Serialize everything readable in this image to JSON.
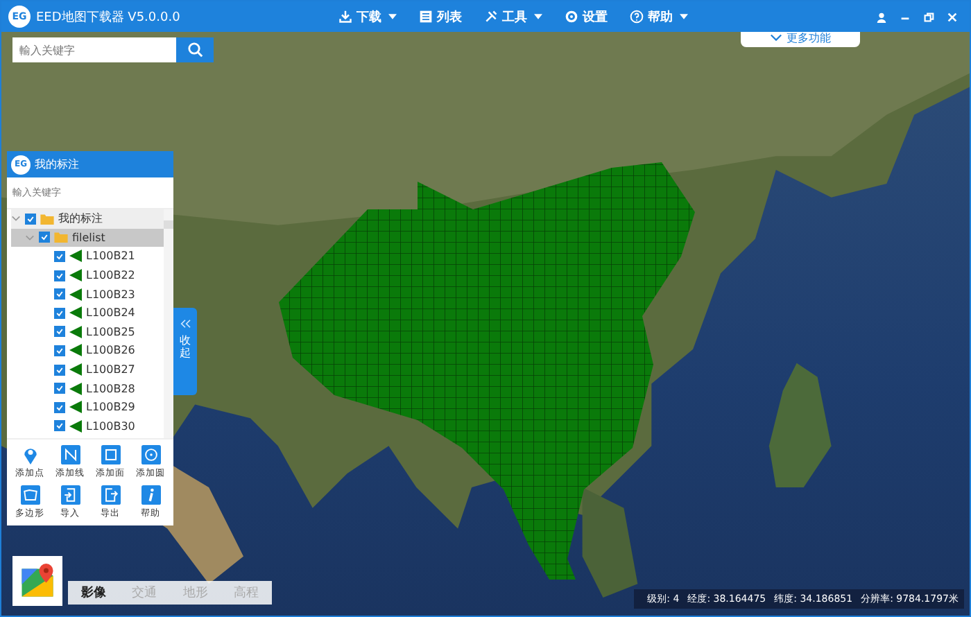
{
  "window": {
    "title": "EED地图下载器 V5.0.0.0",
    "logo": "EG"
  },
  "menu": [
    {
      "label": "下载",
      "kind": "download",
      "dropdown": true
    },
    {
      "label": "列表",
      "kind": "list",
      "dropdown": false
    },
    {
      "label": "工具",
      "kind": "tools",
      "dropdown": true
    },
    {
      "label": "设置",
      "kind": "settings",
      "dropdown": false
    },
    {
      "label": "帮助",
      "kind": "help",
      "dropdown": true
    }
  ],
  "search": {
    "placeholder": "輸入关键字"
  },
  "more_button": {
    "label": "更多功能"
  },
  "panel": {
    "logo": "EG",
    "title": "我的标注",
    "search_placeholder": "輸入关键字",
    "tree": [
      {
        "label": "我的标注",
        "checked": true,
        "expanded": true,
        "selected": false,
        "children": [
          {
            "label": "filelist",
            "checked": true,
            "expanded": true,
            "selected": true,
            "children": [
              {
                "label": "L100B21",
                "checked": true
              },
              {
                "label": "L100B22",
                "checked": true
              },
              {
                "label": "L100B23",
                "checked": true
              },
              {
                "label": "L100B24",
                "checked": true
              },
              {
                "label": "L100B25",
                "checked": true
              },
              {
                "label": "L100B26",
                "checked": true
              },
              {
                "label": "L100B27",
                "checked": true
              },
              {
                "label": "L100B28",
                "checked": true
              },
              {
                "label": "L100B29",
                "checked": true
              },
              {
                "label": "L100B30",
                "checked": true
              }
            ]
          }
        ]
      }
    ],
    "tools": [
      {
        "label": "添加点",
        "kind": "point"
      },
      {
        "label": "添加线",
        "kind": "line"
      },
      {
        "label": "添加面",
        "kind": "area"
      },
      {
        "label": "添加圆",
        "kind": "circle"
      },
      {
        "label": "多边形",
        "kind": "polygon"
      },
      {
        "label": "导入",
        "kind": "import"
      },
      {
        "label": "导出",
        "kind": "export"
      },
      {
        "label": "帮助",
        "kind": "info"
      }
    ]
  },
  "side_tab": {
    "label": "收起"
  },
  "map_types": [
    {
      "label": "影像",
      "selected": true
    },
    {
      "label": "交通",
      "selected": false
    },
    {
      "label": "地形",
      "selected": false
    },
    {
      "label": "高程",
      "selected": false
    }
  ],
  "status": [
    {
      "label": "级别:",
      "value": "4"
    },
    {
      "label": "经度:",
      "value": "38.164475"
    },
    {
      "label": "纬度:",
      "value": "34.186851"
    },
    {
      "label": "分辨率:",
      "value": "9784.1797米"
    }
  ]
}
